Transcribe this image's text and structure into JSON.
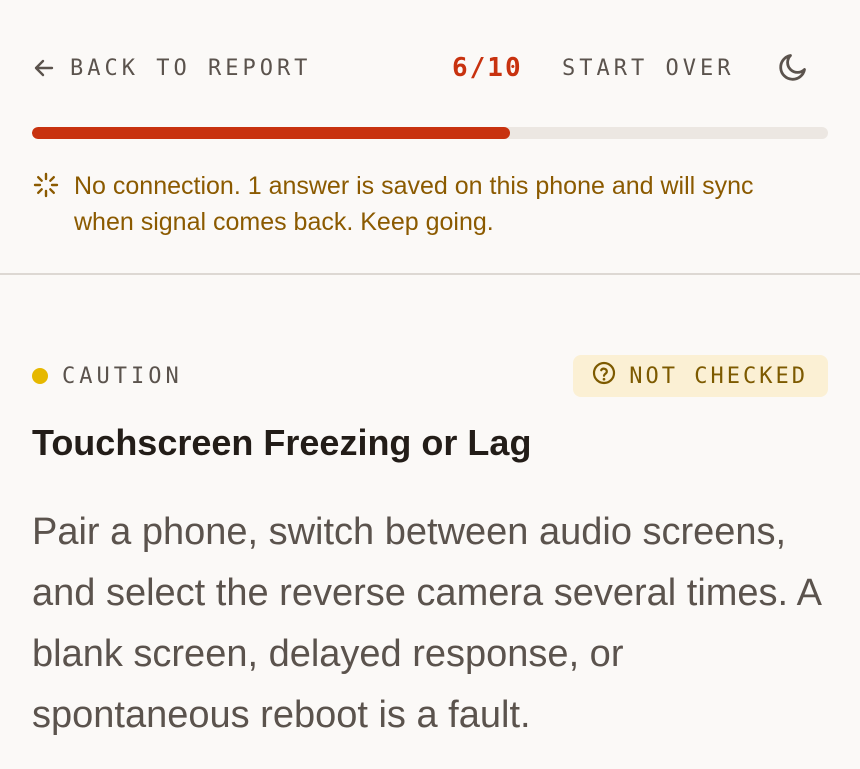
{
  "header": {
    "back_label": "BACK TO REPORT",
    "progress_text": "6/10",
    "start_over_label": "START OVER",
    "theme_icon": "moon-icon",
    "progress_fraction": 0.6
  },
  "notice": {
    "icon": "loading-spinner-icon",
    "text": "No connection. 1 answer is saved on this phone and will sync when signal comes back. Keep going.",
    "color": "#8b5a00"
  },
  "item": {
    "severity": {
      "label": "CAUTION",
      "color": "#e6b800"
    },
    "status": {
      "label": "NOT CHECKED",
      "icon": "question-circle-icon",
      "background": "#fbf0d4",
      "color": "#7d5a00"
    },
    "title": "Touchscreen Freezing or Lag",
    "description": "Pair a phone, switch between audio screens, and select the reverse camera several times. A blank screen, delayed response, or spontaneous reboot is a fault."
  },
  "colors": {
    "accent": "#c8320f",
    "track": "#ece7e2",
    "text": "#5b534d",
    "title": "#231d18"
  }
}
